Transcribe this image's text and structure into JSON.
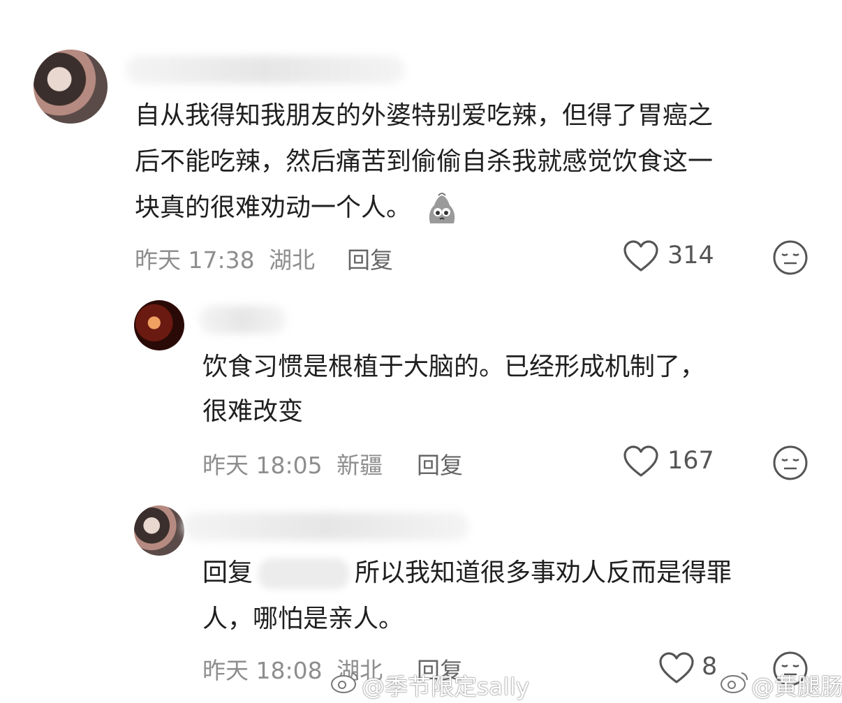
{
  "comments": [
    {
      "lines": [
        "自从我得知我朋友的外婆特别爱吃辣，但得了胃癌之",
        "后不能吃辣，然后痛苦到偷偷自杀我就感觉饮食这一",
        "块真的很难劝动一个人。"
      ],
      "time": "昨天 17:38",
      "location": "湖北",
      "reply_label": "回复",
      "likes": "314",
      "emoji_icon": "sad-face-sticker-icon"
    },
    {
      "lines": [
        "饮食习惯是根植于大脑的。已经形成机制了，",
        "很难改变"
      ],
      "time": "昨天 18:05",
      "location": "新疆",
      "reply_label": "回复",
      "likes": "167"
    },
    {
      "reply_prefix": "回复",
      "line1_rest": "所以我知道很多事劝人反而是得罪",
      "line2": "人，哪怕是亲人。",
      "time": "昨天 18:08",
      "location": "湖北",
      "reply_label": "回复",
      "likes": "8"
    }
  ],
  "watermarks": [
    "@季节限定sally",
    "@黄腿肠"
  ],
  "colors": {
    "text": "#1f1f1f",
    "meta": "#8e8e8e",
    "icon": "#555555"
  }
}
